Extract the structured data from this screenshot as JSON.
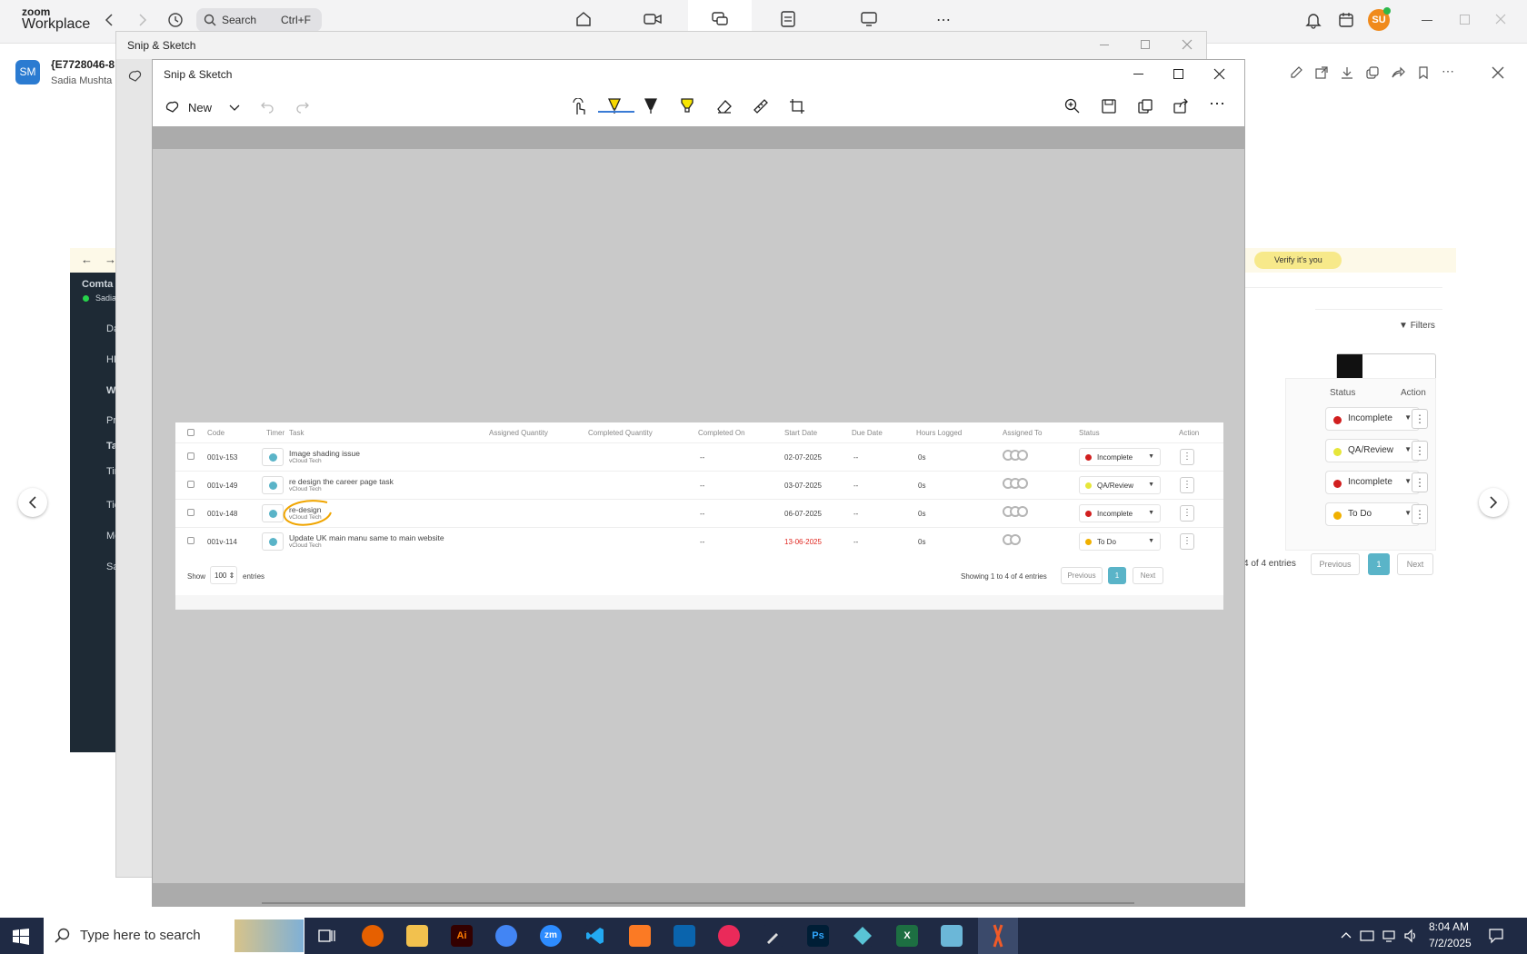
{
  "zoom": {
    "logo_line1": "zoom",
    "logo_line2": "Workplace",
    "search_label": "Search",
    "search_shortcut": "Ctrl+F",
    "avatar_initials": "SU"
  },
  "chat": {
    "avatar": "SM",
    "title": "{E7728046-8",
    "subtitle": "Sadia Mushta"
  },
  "snip_back": {
    "title": "Snip & Sketch"
  },
  "snip_front": {
    "title": "Snip & Sketch",
    "new_label": "New"
  },
  "bg_browser": {
    "verify_label": "Verify it's you",
    "app_name": "Comta",
    "user": "Sadia",
    "sidebar": [
      "Da",
      "HR",
      "W",
      "Pr",
      "Ta",
      "Tin",
      "Tic",
      "Me",
      "Sa"
    ],
    "filters_label": "Filters",
    "status_header": "Status",
    "action_header": "Action",
    "statuses": [
      {
        "label": "Incomplete",
        "color": "#d11f1f"
      },
      {
        "label": "QA/Review",
        "color": "#e6e63a"
      },
      {
        "label": "Incomplete",
        "color": "#d11f1f"
      },
      {
        "label": "To Do",
        "color": "#f0b000"
      }
    ],
    "entries_text": "4 of 4 entries",
    "prev": "Previous",
    "page": "1",
    "next": "Next"
  },
  "shot": {
    "headers": [
      "Code",
      "Timer",
      "Task",
      "Assigned Quantity",
      "Completed Quantity",
      "Completed On",
      "Start Date",
      "Due Date",
      "Hours Logged",
      "Assigned To",
      "Status",
      "Action"
    ],
    "rows": [
      {
        "code": "001v-153",
        "task": "Image shading issue",
        "company": "vCloud Tech",
        "completed_on": "--",
        "start": "02-07-2025",
        "due": "--",
        "hours": "0s",
        "status": "Incomplete",
        "status_color": "#d11f1f",
        "due_color": "#444"
      },
      {
        "code": "001v-149",
        "task": "re design the career page task",
        "company": "vCloud Tech",
        "completed_on": "--",
        "start": "03-07-2025",
        "due": "--",
        "hours": "0s",
        "status": "QA/Review",
        "status_color": "#e6e63a",
        "due_color": "#444"
      },
      {
        "code": "001v-148",
        "task": "re-design",
        "company": "vCloud Tech",
        "completed_on": "--",
        "start": "06-07-2025",
        "due": "--",
        "hours": "0s",
        "status": "Incomplete",
        "status_color": "#d11f1f",
        "due_color": "#444"
      },
      {
        "code": "001v-114",
        "task": "Update UK main manu same to main website",
        "company": "vCloud Tech",
        "completed_on": "--",
        "start": "13-06-2025",
        "due": "--",
        "hours": "0s",
        "status": "To Do",
        "status_color": "#f0b000",
        "due_color": "#444"
      }
    ],
    "show_label": "Show",
    "show_value": "100",
    "entries_label": "entries",
    "showing_text": "Showing 1 to 4 of 4 entries",
    "prev": "Previous",
    "page": "1",
    "next": "Next"
  },
  "taskbar": {
    "search_placeholder": "Type here to search",
    "time": "8:04 AM",
    "date": "7/2/2025"
  },
  "colors": {
    "accent": "#3a7bd5",
    "pager_active": "#5ab4c8",
    "annotation": "#f0a500"
  }
}
